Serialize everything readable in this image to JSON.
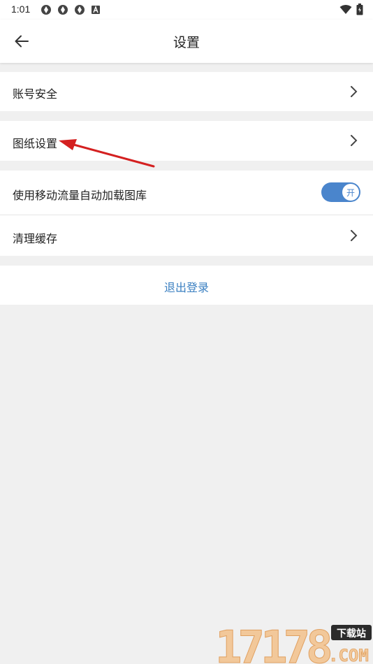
{
  "status_bar": {
    "time": "1:01",
    "left_icons": [
      "sync-icon",
      "sync-icon",
      "sync-icon",
      "a-icon"
    ],
    "right_icons": [
      "wifi-icon",
      "battery-icon"
    ]
  },
  "app_bar": {
    "back_icon": "arrow-left-icon",
    "title": "设置"
  },
  "settings": {
    "account_security": "账号安全",
    "drawing_settings": "图纸设置",
    "auto_load_gallery": "使用移动流量自动加载图库",
    "auto_load_toggle_label": "开",
    "auto_load_toggle_on": true,
    "clear_cache": "清理缓存",
    "logout": "退出登录"
  },
  "watermark": {
    "digits": "17178",
    "badge": "下载站",
    "suffix": ".COM"
  },
  "colors": {
    "accent": "#4a85cc",
    "link": "#3a7fc1",
    "background": "#f0f0f0",
    "arrow_annotation": "#d42020"
  }
}
